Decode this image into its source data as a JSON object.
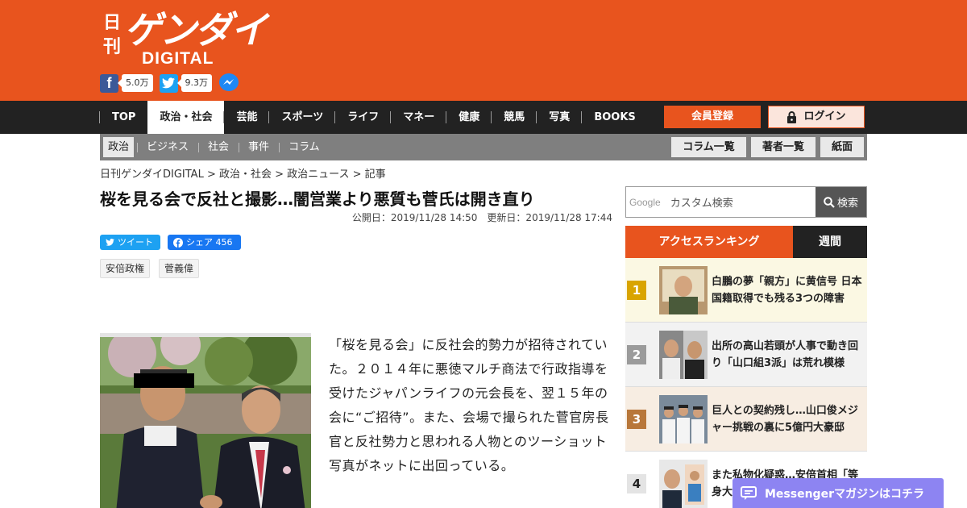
{
  "brand": {
    "logo_small": "日刊",
    "logo_big": "ゲンダイ",
    "logo_sub": "DIGITAL",
    "accent_color": "#e8541e"
  },
  "social": {
    "facebook_count": "5.0万",
    "twitter_count": "9.3万",
    "icons": [
      "facebook-icon",
      "twitter-icon",
      "messenger-icon"
    ]
  },
  "nav": {
    "items": [
      "TOP",
      "政治・社会",
      "芸能",
      "スポーツ",
      "ライフ",
      "マネー",
      "健康",
      "競馬",
      "写真",
      "BOOKS"
    ],
    "active": "政治・社会",
    "register_label": "会員登録",
    "login_label": "ログイン"
  },
  "subnav": {
    "items": [
      "政治",
      "ビジネス",
      "社会",
      "事件",
      "コラム"
    ],
    "active": "政治",
    "buttons": [
      "コラム一覧",
      "著者一覧",
      "紙面"
    ]
  },
  "breadcrumb": "日刊ゲンダイDIGITAL > 政治・社会 > 政治ニュース > 記事",
  "article": {
    "title": "桜を見る会で反社と撮影…闇営業より悪質も菅氏は開き直り",
    "dates": "公開日：2019/11/28 14:50　更新日：2019/11/28 17:44",
    "tweet_label": "ツイート",
    "share_label": "シェア 456",
    "tags": [
      "安倍政権",
      "菅義偉"
    ],
    "body": "「桜を見る会」に反社会的勢力が招待されていた。２０１４年に悪徳マルチ商法で行政指導を受けたジャパンライフの元会長を、翌１５年の会に“ご招待”。また、会場で撮られた菅官房長官と反社勢力と思われる人物とのツーショット写真がネットに出回っている。"
  },
  "sidebar": {
    "search_brand": "Google",
    "search_placeholder": "カスタム検索",
    "search_button": "検索",
    "ranking_tab": "アクセスランキング",
    "weekly_tab": "週間",
    "ranking": [
      {
        "rank": "1",
        "title": "白鵬の夢「親方」に黄信号 日本国籍取得でも残る3つの障害",
        "color": "#d9a400",
        "bg": "#fbf8e3"
      },
      {
        "rank": "2",
        "title": "出所の高山若頭が人事で動き回り「山口組3派」は荒れ模様",
        "color": "#9b9b9b",
        "bg": "#f2f2f2"
      },
      {
        "rank": "3",
        "title": "巨人との契約残し…山口俊メジャー挑戦の裏に5億円大豪邸",
        "color": "#b8773a",
        "bg": "#f7ede2"
      },
      {
        "rank": "4",
        "title": "また私物化疑惑…安倍首相「等身大",
        "color": "#e4e4e4",
        "bg": "#ffffff"
      }
    ]
  },
  "messenger_banner": "Messengerマガジンはコチラ"
}
